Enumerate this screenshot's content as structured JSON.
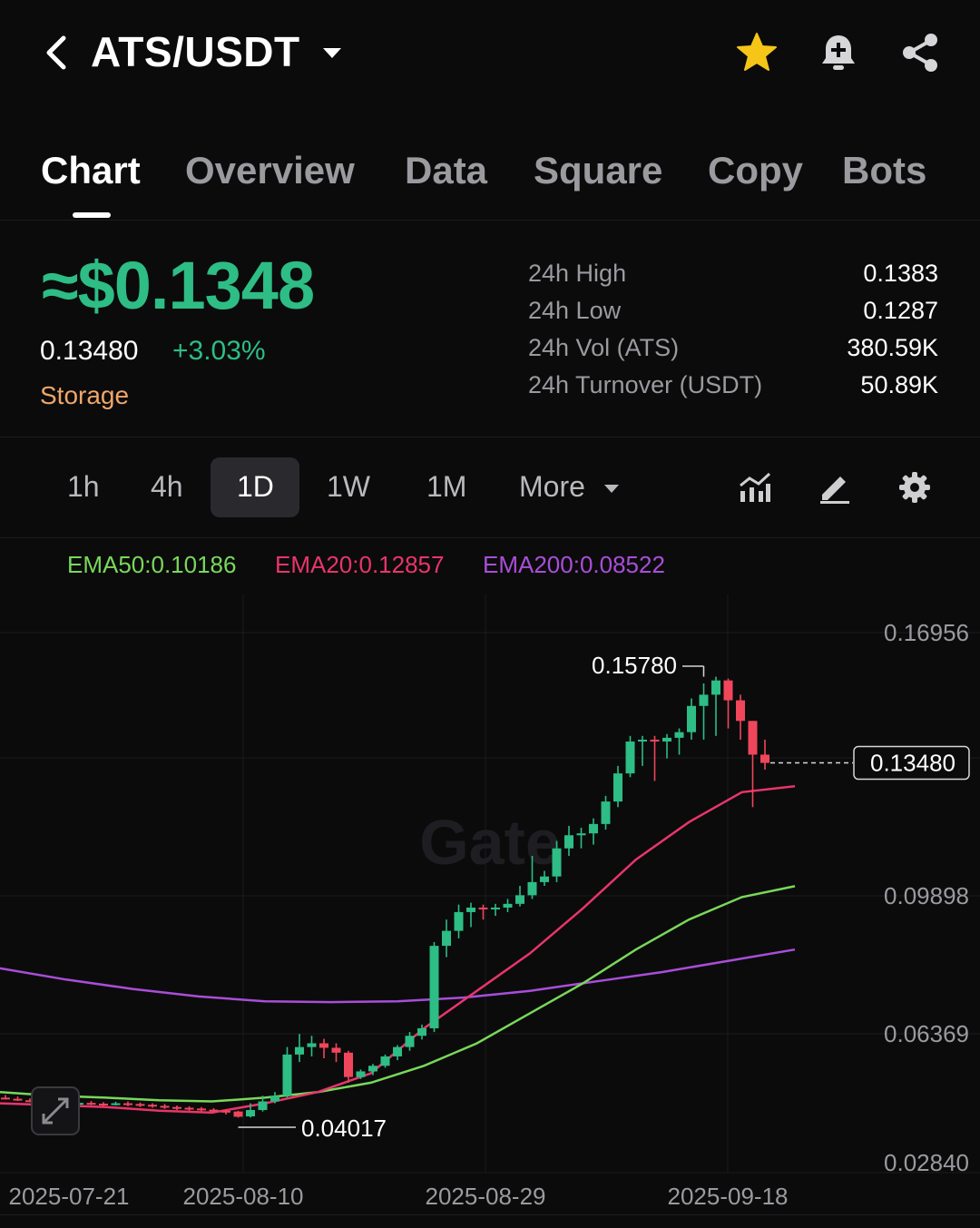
{
  "header": {
    "pair": "ATS/USDT",
    "icons": [
      "back-arrow-icon",
      "dropdown-caret-icon",
      "star-icon",
      "bell-add-icon",
      "share-icon"
    ]
  },
  "tabs": [
    "Chart",
    "Overview",
    "Data",
    "Square",
    "Copy",
    "Bots"
  ],
  "summary": {
    "price_usd": "≈$0.1348",
    "price": "0.13480",
    "change": "+3.03%",
    "tag": "Storage",
    "stats": [
      {
        "label": "24h High",
        "value": "0.1383"
      },
      {
        "label": "24h Low",
        "value": "0.1287"
      },
      {
        "label": "24h Vol (ATS)",
        "value": "380.59K"
      },
      {
        "label": "24h Turnover (USDT)",
        "value": "50.89K"
      }
    ]
  },
  "timeframes": {
    "items": [
      "1h",
      "4h",
      "1D",
      "1W",
      "1M"
    ],
    "more": "More",
    "selected": "1D"
  },
  "indicators": {
    "ema50": "EMA50:0.10186",
    "ema20": "EMA20:0.12857",
    "ema200": "EMA200:0.08522"
  },
  "colors": {
    "up": "#2dbd85",
    "down": "#f0465b",
    "ema50": "#79d85a",
    "ema20": "#e8356a",
    "ema200": "#a94ed8",
    "accent_star": "#f5c518"
  },
  "chart_data": {
    "type": "candlestick",
    "y_ticks": [
      "0.16956",
      "0.09898",
      "0.06369",
      "0.02840"
    ],
    "x_ticks": [
      "2025-07-21",
      "2025-08-10",
      "2025-08-29",
      "2025-09-18"
    ],
    "last_price_label": "0.13480",
    "max_label": "0.15780",
    "min_label": "0.04017",
    "watermark": "Gate",
    "series": [
      {
        "name": "EMA50",
        "values": [
          0.047,
          0.046,
          0.0455,
          0.0448,
          0.0445,
          0.0455,
          0.047,
          0.0495,
          0.054,
          0.06,
          0.068,
          0.076,
          0.085,
          0.093,
          0.099,
          0.1019
        ]
      },
      {
        "name": "EMA20",
        "values": [
          0.044,
          0.0435,
          0.043,
          0.042,
          0.0415,
          0.044,
          0.047,
          0.052,
          0.064,
          0.074,
          0.084,
          0.096,
          0.109,
          0.119,
          0.127,
          0.1286
        ]
      },
      {
        "name": "EMA200",
        "values": [
          0.08,
          0.077,
          0.0745,
          0.0725,
          0.0712,
          0.071,
          0.0712,
          0.0722,
          0.074,
          0.0765,
          0.079,
          0.082,
          0.085
        ]
      }
    ]
  }
}
